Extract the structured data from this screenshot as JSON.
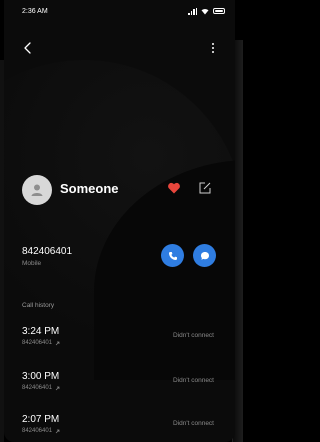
{
  "status_bar": {
    "time": "2:36 AM"
  },
  "contact": {
    "name": "Someone"
  },
  "phone": {
    "number": "842406401",
    "type": "Mobile"
  },
  "history": {
    "label": "Call history",
    "entries": [
      {
        "time": "3:24 PM",
        "number": "842406401",
        "status": "Didn't connect"
      },
      {
        "time": "3:00 PM",
        "number": "842406401",
        "status": "Didn't connect"
      },
      {
        "time": "2:07 PM",
        "number": "842406401",
        "status": "Didn't connect"
      }
    ]
  },
  "colors": {
    "accent": "#2f7de1",
    "favorite": "#e8463c",
    "background": "#0b0b0b"
  },
  "icons": [
    "back-arrow-icon",
    "more-options-icon",
    "heart-icon",
    "edit-icon",
    "phone-icon",
    "chat-icon",
    "outgoing-call-icon"
  ]
}
